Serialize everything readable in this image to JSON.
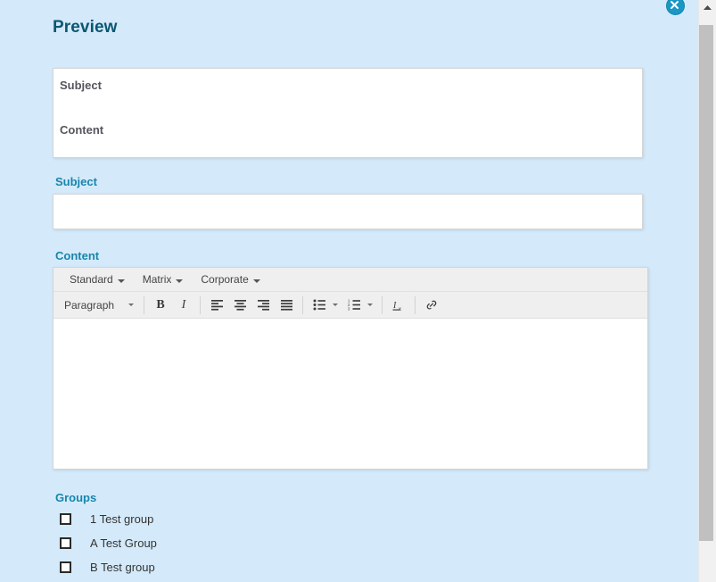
{
  "window": {
    "title": "Preview",
    "close_icon": "close-circle-icon"
  },
  "preview": {
    "subject_text": "Subject",
    "content_text": "Content"
  },
  "fields": {
    "subject": {
      "label": "Subject",
      "value": "",
      "placeholder": ""
    },
    "content": {
      "label": "Content",
      "value": ""
    }
  },
  "editor": {
    "menus": [
      {
        "label": "Standard",
        "icon": "chevron-down-icon"
      },
      {
        "label": "Matrix",
        "icon": "chevron-down-icon"
      },
      {
        "label": "Corporate",
        "icon": "chevron-down-icon"
      }
    ],
    "style_select": {
      "value": "Paragraph",
      "icon": "chevron-down-icon"
    },
    "buttons": [
      {
        "name": "bold-button",
        "label": "B"
      },
      {
        "name": "italic-button",
        "label": "I"
      },
      {
        "name": "align-left-button",
        "label": ""
      },
      {
        "name": "align-center-button",
        "label": ""
      },
      {
        "name": "align-right-button",
        "label": ""
      },
      {
        "name": "align-justify-button",
        "label": ""
      },
      {
        "name": "bullet-list-button",
        "label": ""
      },
      {
        "name": "numbered-list-button",
        "label": ""
      },
      {
        "name": "remove-format-button",
        "label": ""
      },
      {
        "name": "insert-link-button",
        "label": ""
      }
    ]
  },
  "groups": {
    "label": "Groups",
    "items": [
      {
        "label": "1 Test group",
        "checked": false
      },
      {
        "label": "A Test Group",
        "checked": false
      },
      {
        "label": "B Test group",
        "checked": false
      }
    ]
  },
  "scrollbar": {
    "up_arrow_icon": "triangle-up-icon"
  },
  "colors": {
    "background": "#d4eafa",
    "accent": "#1885ab",
    "title": "#0b5673",
    "close_button": "#1a97c4"
  }
}
